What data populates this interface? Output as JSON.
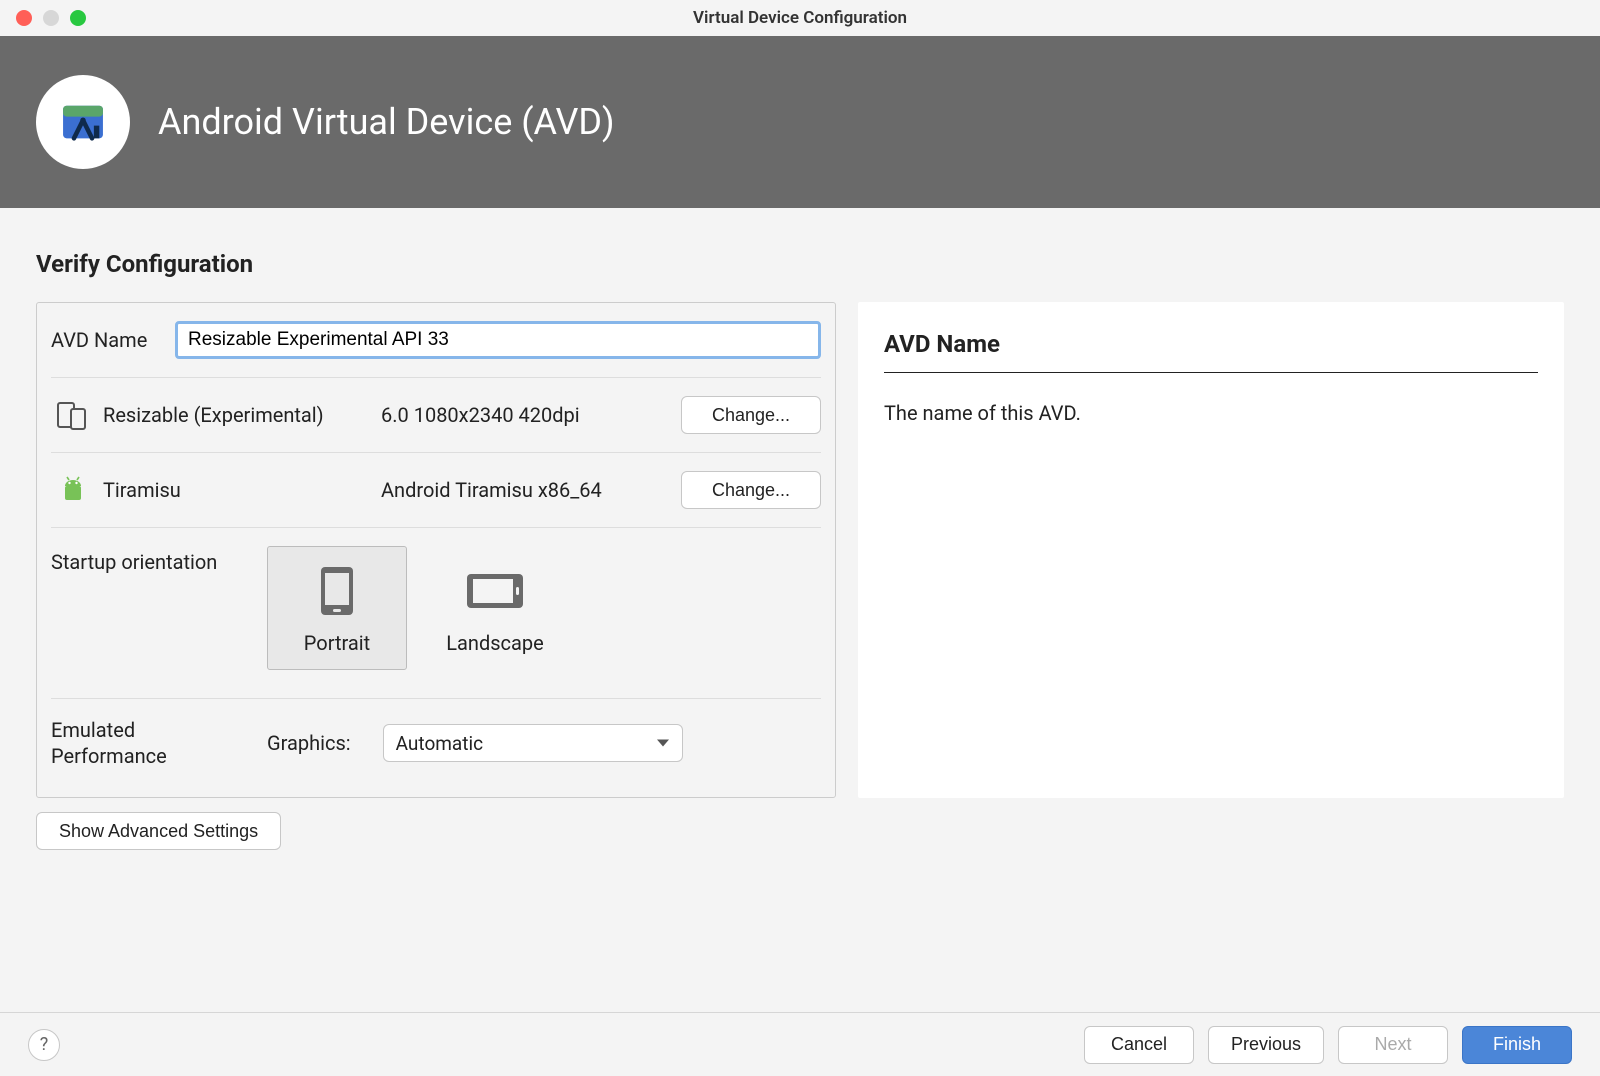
{
  "window": {
    "title": "Virtual Device Configuration"
  },
  "header": {
    "title": "Android Virtual Device (AVD)"
  },
  "section_title": "Verify Configuration",
  "avd_name": {
    "label": "AVD Name",
    "value": "Resizable Experimental API 33"
  },
  "device": {
    "name": "Resizable (Experimental)",
    "specs": "6.0 1080x2340 420dpi",
    "change_label": "Change..."
  },
  "system_image": {
    "name": "Tiramisu",
    "specs": "Android Tiramisu x86_64",
    "change_label": "Change..."
  },
  "orientation": {
    "label": "Startup orientation",
    "portrait_label": "Portrait",
    "landscape_label": "Landscape"
  },
  "performance": {
    "label": "Emulated\nPerformance",
    "graphics_label": "Graphics:",
    "graphics_value": "Automatic"
  },
  "advanced_label": "Show Advanced Settings",
  "side_panel": {
    "title": "AVD Name",
    "description": "The name of this AVD."
  },
  "footer": {
    "help": "?",
    "cancel": "Cancel",
    "previous": "Previous",
    "next": "Next",
    "finish": "Finish"
  }
}
